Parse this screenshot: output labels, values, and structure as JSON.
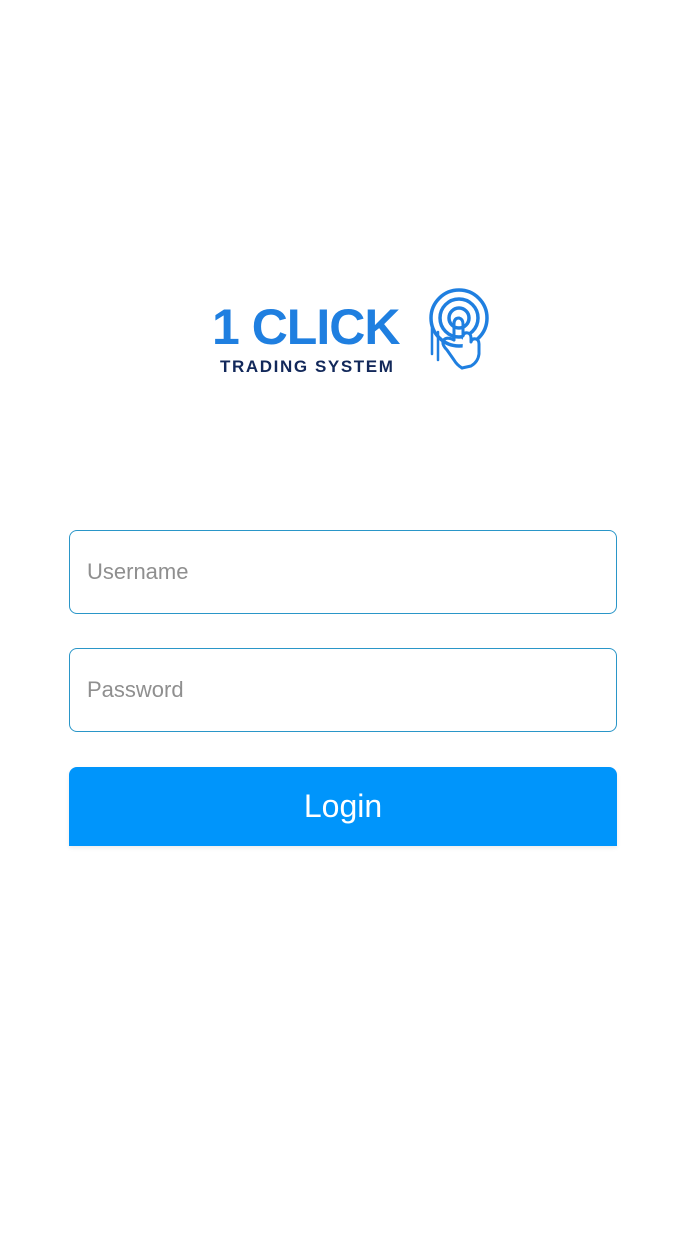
{
  "logo": {
    "brand": "1 CLICK",
    "tagline": "TRADING SYSTEM",
    "icon": "hand-tap-icon",
    "colors": {
      "brand": "#1f7fe0",
      "tagline": "#12285a"
    }
  },
  "form": {
    "username_placeholder": "Username",
    "password_placeholder": "Password",
    "login_label": "Login"
  },
  "colors": {
    "field_border": "#2a96c8",
    "button_bg": "#0095fb",
    "button_text": "#ffffff",
    "placeholder": "#8f8f8f"
  }
}
